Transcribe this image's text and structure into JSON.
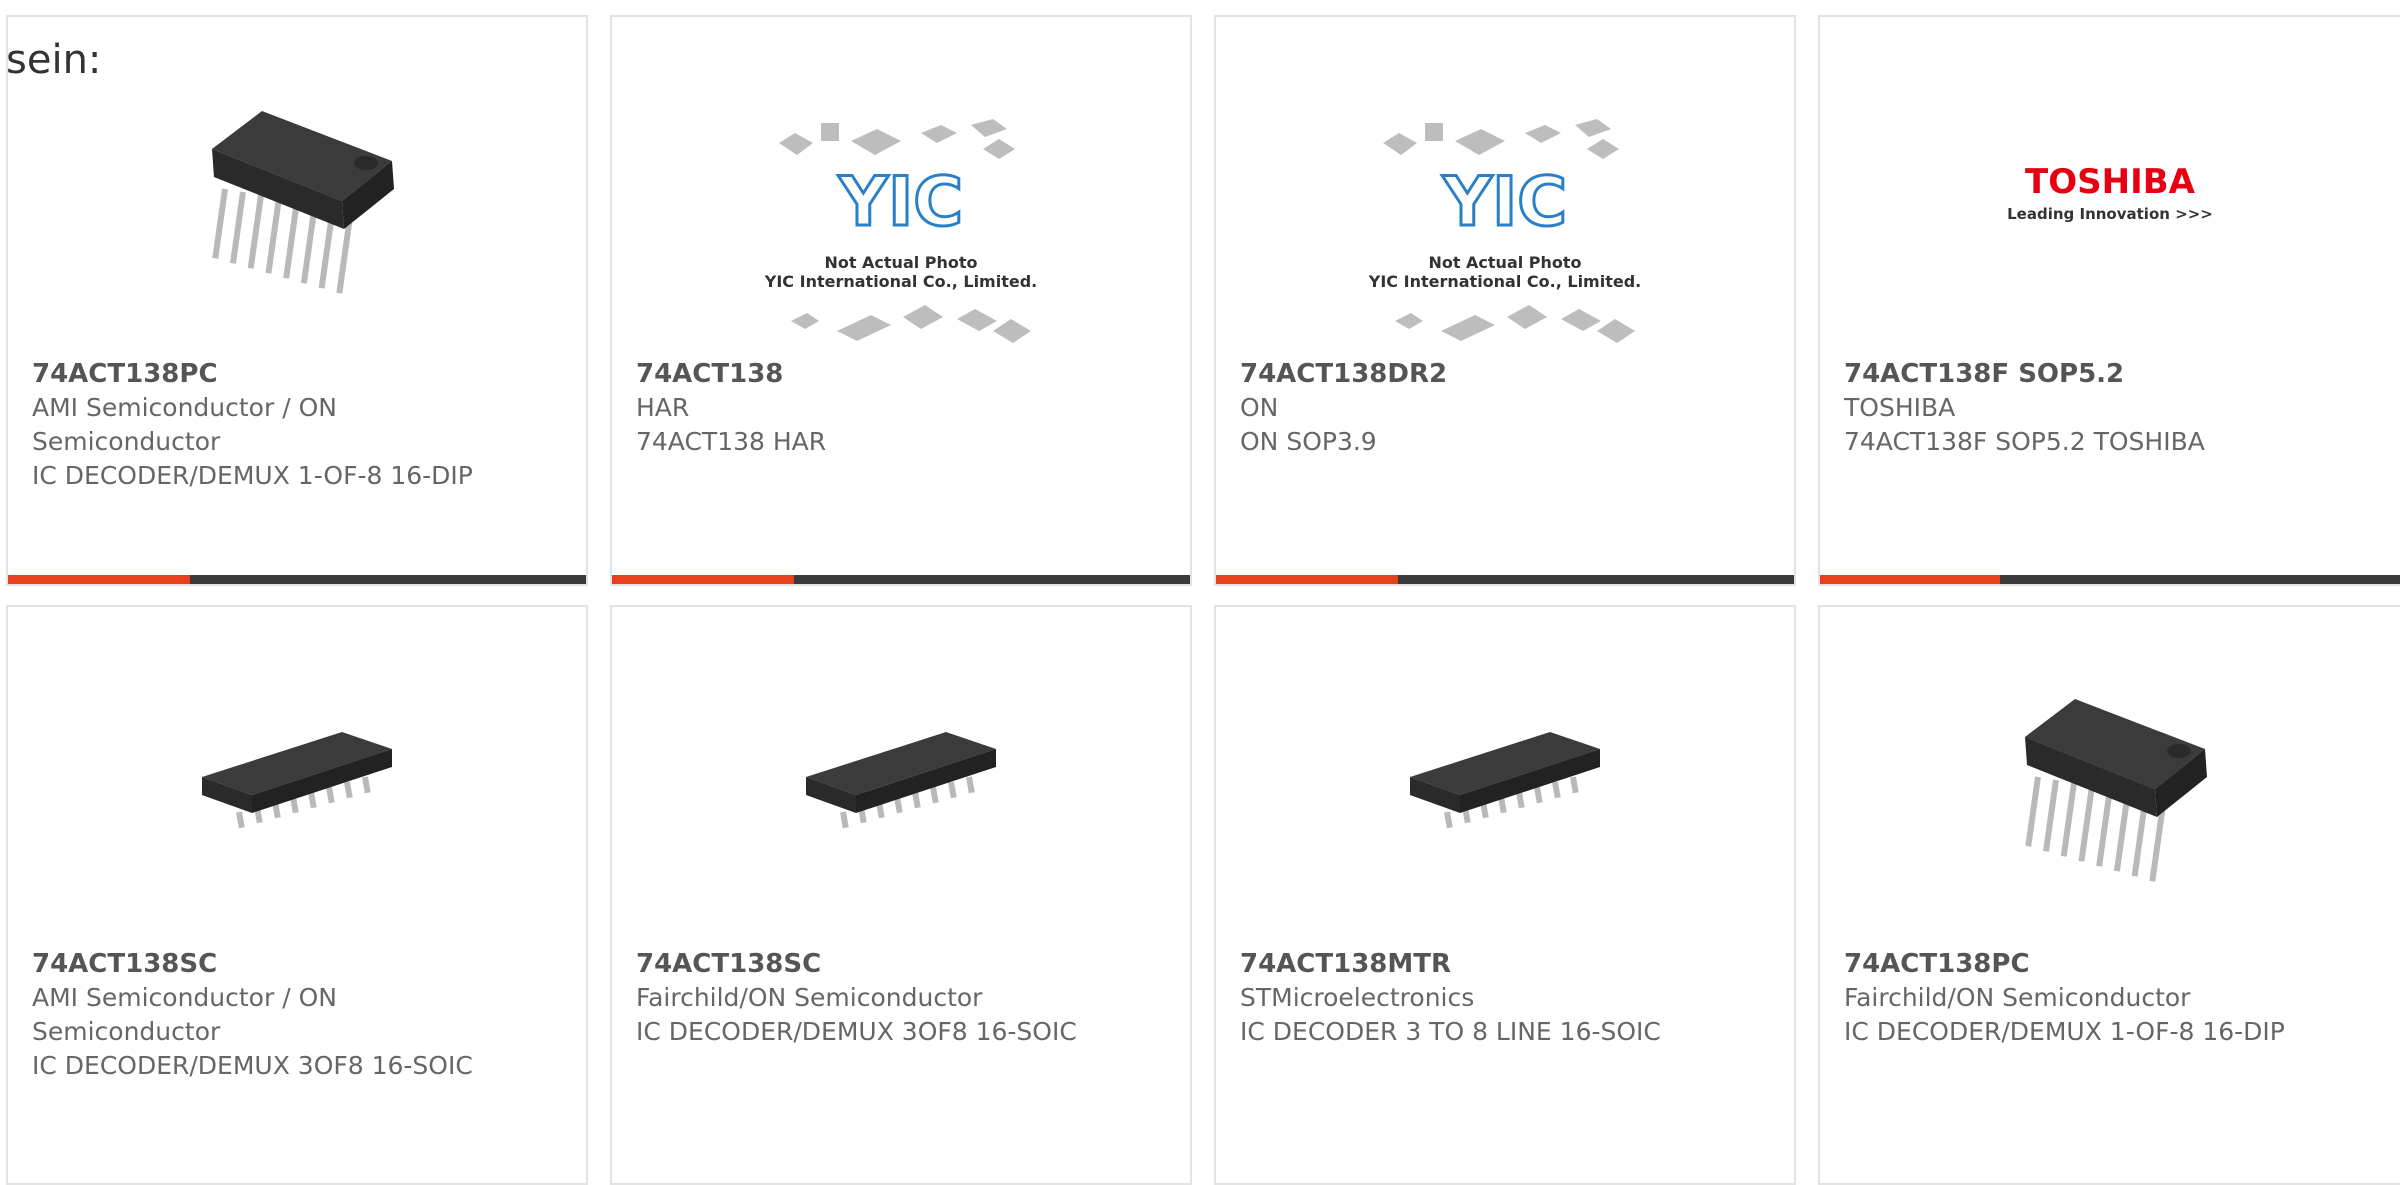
{
  "lead_text": "sein:",
  "accent_color": "#e8401c",
  "bar_color": "#3a3a3a",
  "products": [
    {
      "part": "74ACT138PC",
      "manufacturer": "AMI Semiconductor / ON Semiconductor",
      "description": "IC DECODER/DEMUX 1-OF-8 16-DIP",
      "image": "dip16-chip-icon"
    },
    {
      "part": "74ACT138",
      "manufacturer": "HAR",
      "description": "74ACT138 HAR",
      "image": "yic-placeholder",
      "image_text": {
        "logo": "YIC",
        "line1": "Not Actual Photo",
        "line2": "YIC International Co., Limited."
      }
    },
    {
      "part": "74ACT138DR2",
      "manufacturer": "ON",
      "description": "ON SOP3.9",
      "image": "yic-placeholder",
      "image_text": {
        "logo": "YIC",
        "line1": "Not Actual Photo",
        "line2": "YIC International Co., Limited."
      }
    },
    {
      "part": "74ACT138F SOP5.2",
      "manufacturer": "TOSHIBA",
      "description": "74ACT138F SOP5.2 TOSHIBA",
      "image": "toshiba-logo",
      "image_text": {
        "logo": "TOSHIBA",
        "tagline": "Leading Innovation >>>"
      }
    },
    {
      "part": "74ACT138SC",
      "manufacturer": "AMI Semiconductor / ON Semiconductor",
      "description": "IC DECODER/DEMUX 3OF8 16-SOIC",
      "image": "soic16-chip-icon"
    },
    {
      "part": "74ACT138SC",
      "manufacturer": "Fairchild/ON Semiconductor",
      "description": "IC DECODER/DEMUX 3OF8 16-SOIC",
      "image": "soic16-chip-icon"
    },
    {
      "part": "74ACT138MTR",
      "manufacturer": "STMicroelectronics",
      "description": "IC DECODER 3 TO 8 LINE 16-SOIC",
      "image": "soic16-chip-icon"
    },
    {
      "part": "74ACT138PC",
      "manufacturer": "Fairchild/ON Semiconductor",
      "description": "IC DECODER/DEMUX 1-OF-8 16-DIP",
      "image": "dip16-chip-icon"
    }
  ]
}
